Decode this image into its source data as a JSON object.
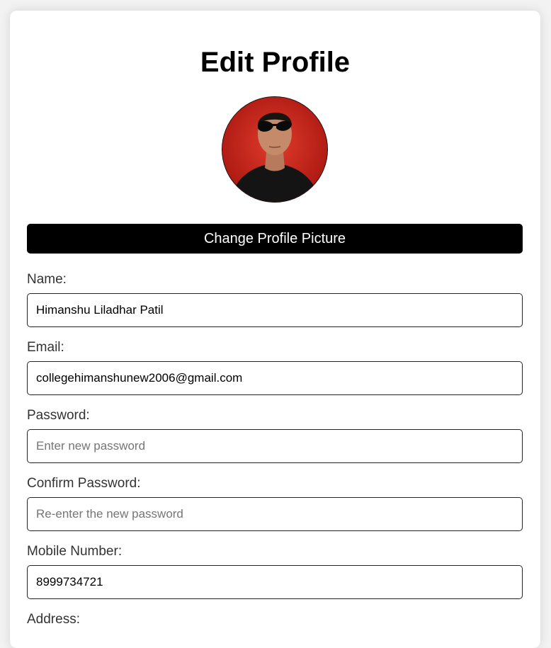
{
  "page": {
    "title": "Edit Profile"
  },
  "profile_picture": {
    "change_label": "Change Profile Picture"
  },
  "fields": {
    "name": {
      "label": "Name:",
      "value": "Himanshu Liladhar Patil",
      "placeholder": ""
    },
    "email": {
      "label": "Email:",
      "value": "collegehimanshunew2006@gmail.com",
      "placeholder": ""
    },
    "password": {
      "label": "Password:",
      "value": "",
      "placeholder": "Enter new password"
    },
    "confirm_password": {
      "label": "Confirm Password:",
      "value": "",
      "placeholder": "Re-enter the new password"
    },
    "mobile": {
      "label": "Mobile Number:",
      "value": "8999734721",
      "placeholder": ""
    },
    "address": {
      "label": "Address:"
    }
  },
  "colors": {
    "button_bg": "#000000",
    "button_text": "#ffffff",
    "avatar_bg": "#c8231b"
  }
}
